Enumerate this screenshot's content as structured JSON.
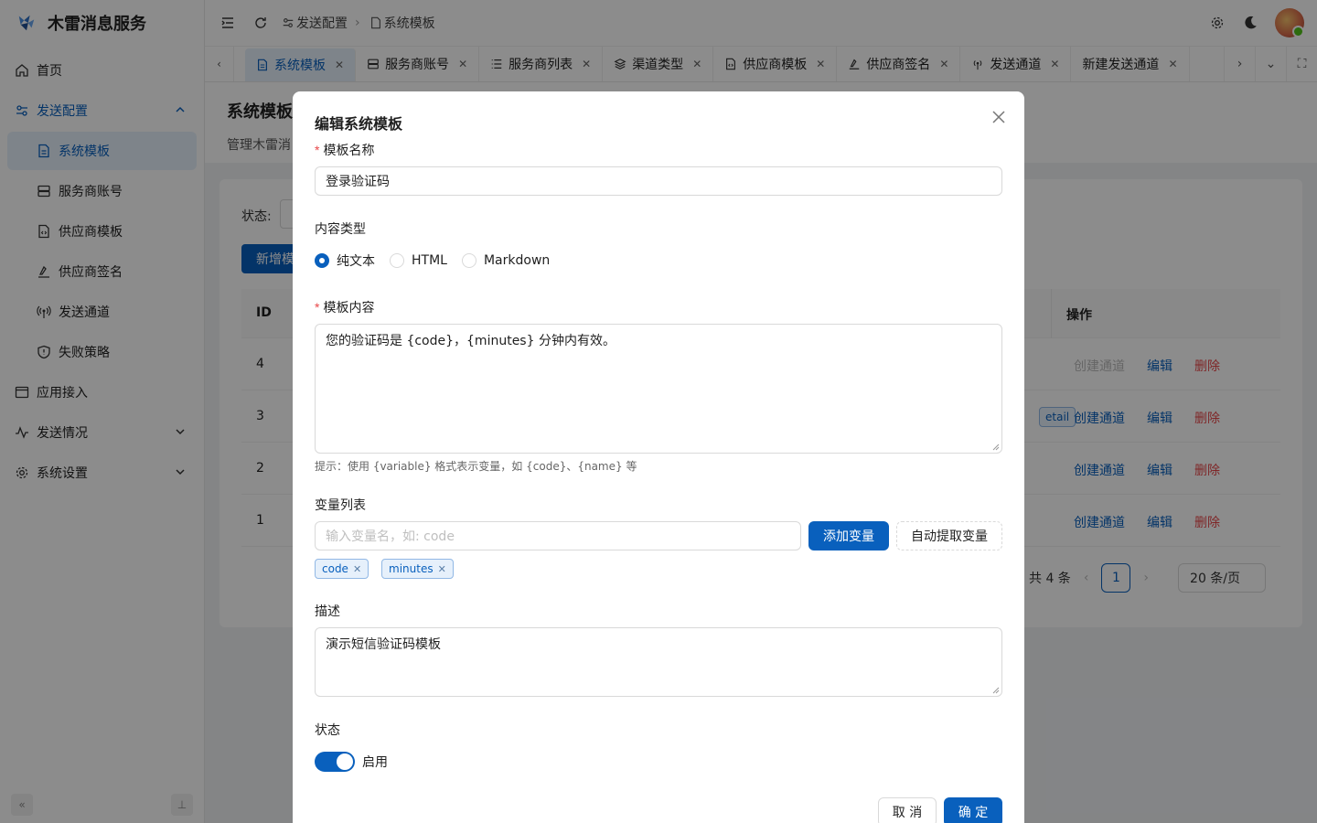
{
  "app": {
    "title": "木雷消息服务"
  },
  "sidebar": {
    "items": [
      {
        "label": "首页"
      },
      {
        "label": "发送配置"
      },
      {
        "label": "系统模板"
      },
      {
        "label": "服务商账号"
      },
      {
        "label": "供应商模板"
      },
      {
        "label": "供应商签名"
      },
      {
        "label": "发送通道"
      },
      {
        "label": "失败策略"
      },
      {
        "label": "应用接入"
      },
      {
        "label": "发送情况"
      },
      {
        "label": "系统设置"
      }
    ]
  },
  "header": {
    "breadcrumb": [
      "发送配置",
      "系统模板"
    ]
  },
  "tabs": [
    {
      "label": "系统模板"
    },
    {
      "label": "服务商账号"
    },
    {
      "label": "服务商列表"
    },
    {
      "label": "渠道类型"
    },
    {
      "label": "供应商模板"
    },
    {
      "label": "供应商签名"
    },
    {
      "label": "发送通道"
    },
    {
      "label": "新建发送通道"
    }
  ],
  "page": {
    "title": "系统模板",
    "description": "管理木雷消",
    "filter_label": "状态:",
    "add_button": "新增模",
    "table": {
      "headers": {
        "id": "ID",
        "actions": "操作"
      },
      "rows": [
        {
          "id": "4",
          "create": "创建通道",
          "edit": "编辑",
          "delete": "删除"
        },
        {
          "id": "3",
          "tag": "etail",
          "create": "创建通道",
          "edit": "编辑",
          "delete": "删除"
        },
        {
          "id": "2",
          "create": "创建通道",
          "edit": "编辑",
          "delete": "删除"
        },
        {
          "id": "1",
          "create": "创建通道",
          "edit": "编辑",
          "delete": "删除"
        }
      ]
    },
    "pagination": {
      "total": "共 4 条",
      "current": "1",
      "page_size": "20 条/页"
    }
  },
  "modal": {
    "title": "编辑系统模板",
    "name_label": "模板名称",
    "name_value": "登录验证码",
    "content_type_label": "内容类型",
    "content_types": [
      "纯文本",
      "HTML",
      "Markdown"
    ],
    "content_type_selected": "纯文本",
    "content_label": "模板内容",
    "content_value": "您的验证码是 {code}，{minutes} 分钟内有效。",
    "content_hint": "提示：使用 {variable} 格式表示变量，如 {code}、{name} 等",
    "variables_label": "变量列表",
    "variable_placeholder": "输入变量名，如: code",
    "add_variable_button": "添加变量",
    "auto_extract_button": "自动提取变量",
    "variables": [
      "code",
      "minutes"
    ],
    "description_label": "描述",
    "description_value": "演示短信验证码模板",
    "status_label": "状态",
    "status_value": "启用",
    "cancel_button": "取 消",
    "ok_button": "确 定"
  },
  "colors": {
    "primary": "#0960bd",
    "danger": "#e84749"
  }
}
